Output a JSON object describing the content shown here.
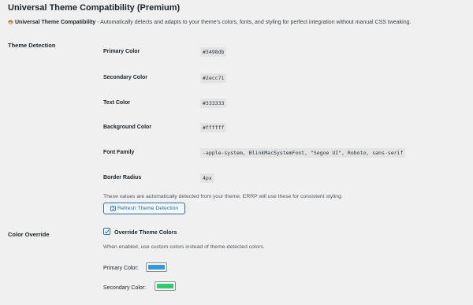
{
  "header": {
    "title": "Universal Theme Compatibility (Premium)",
    "desc_name": "Universal Theme Compatibility",
    "desc_text": " - Automatically detects and adapts to your theme's colors, fonts, and styling for perfect integration without manual CSS tweaking."
  },
  "theme_detection": {
    "section_label": "Theme Detection",
    "rows": [
      {
        "label": "Primary Color",
        "value": "#3498db"
      },
      {
        "label": "Secondary Color",
        "value": "#2ecc71"
      },
      {
        "label": "Text Color",
        "value": "#333333"
      },
      {
        "label": "Background Color",
        "value": "#ffffff"
      },
      {
        "label": "Font Family",
        "value": "-apple-system, BlinkMacSystemFont, \"Segoe UI\", Roboto, sans-serif"
      },
      {
        "label": "Border Radius",
        "value": "4px"
      }
    ],
    "help": "These values are automatically detected from your theme. ERRP will use these for consistent styling.",
    "refresh_label": "Refresh Theme Detection"
  },
  "color_override": {
    "section_label": "Color Override",
    "checkbox_label": "Override Theme Colors",
    "checked": true,
    "help": "When enabled, use custom colors instead of theme-detected colors.",
    "primary_label": "Primary Color:",
    "primary_color": "#3498db",
    "secondary_label": "Secondary Color:",
    "secondary_color": "#2ecc71"
  },
  "colors": {
    "accent": "#2271b1",
    "background": "#f0f0f1"
  }
}
